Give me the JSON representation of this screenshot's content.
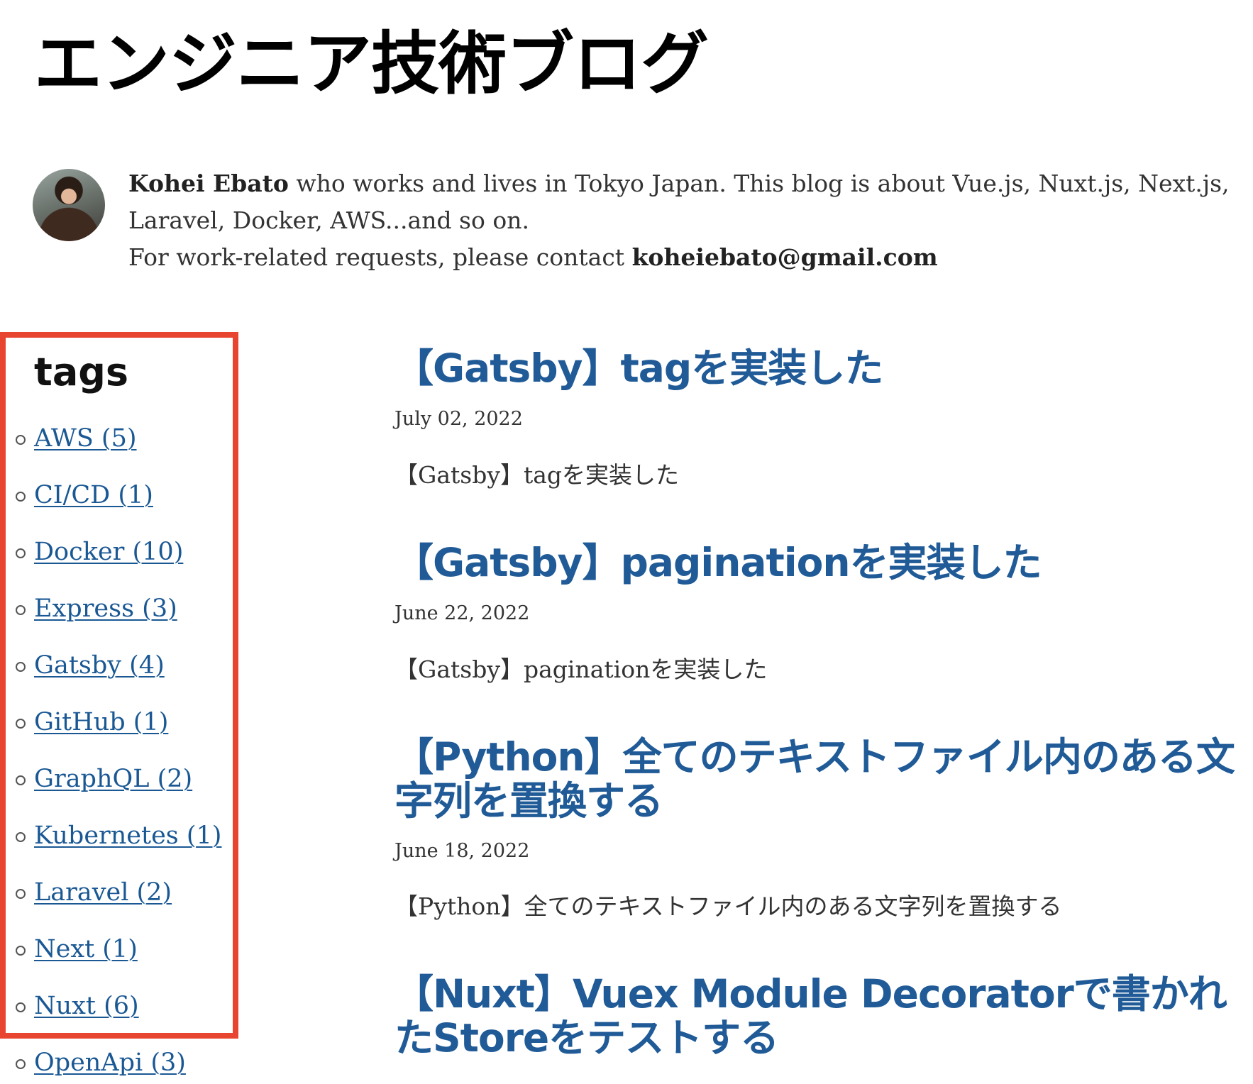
{
  "site": {
    "title": "エンジニア技術ブログ"
  },
  "bio": {
    "author": "Kohei Ebato",
    "line1": " who works and lives in Tokyo Japan. This blog is about Vue.js, Nuxt.js, Next.js, Laravel, Docker, AWS...and so on.",
    "contact_prefix": "For work-related requests, please contact ",
    "email": "koheiebato@gmail.com"
  },
  "tags": {
    "heading": "tags",
    "items": [
      {
        "label": "AWS (5)"
      },
      {
        "label": "CI/CD (1)"
      },
      {
        "label": "Docker (10)"
      },
      {
        "label": "Express (3)"
      },
      {
        "label": "Gatsby (4)"
      },
      {
        "label": "GitHub (1)"
      },
      {
        "label": "GraphQL (2)"
      },
      {
        "label": "Kubernetes (1)"
      },
      {
        "label": "Laravel (2)"
      },
      {
        "label": "Next (1)"
      },
      {
        "label": "Nuxt (6)"
      },
      {
        "label": "OpenApi (3)"
      }
    ]
  },
  "posts": [
    {
      "title": "【Gatsby】tagを実装した",
      "date": "July 02, 2022",
      "excerpt": "【Gatsby】tagを実装した"
    },
    {
      "title": "【Gatsby】paginationを実装した",
      "date": "June 22, 2022",
      "excerpt": "【Gatsby】paginationを実装した"
    },
    {
      "title": "【Python】全てのテキストファイル内のある文字列を置換する",
      "date": "June 18, 2022",
      "excerpt": "【Python】全てのテキストファイル内のある文字列を置換する"
    },
    {
      "title": "【Nuxt】Vuex Module Decoratorで書かれたStoreをテストする",
      "date": "",
      "excerpt": ""
    }
  ],
  "colors": {
    "link": "#1a5894",
    "post_title": "#205b97",
    "highlight": "#e84531"
  }
}
